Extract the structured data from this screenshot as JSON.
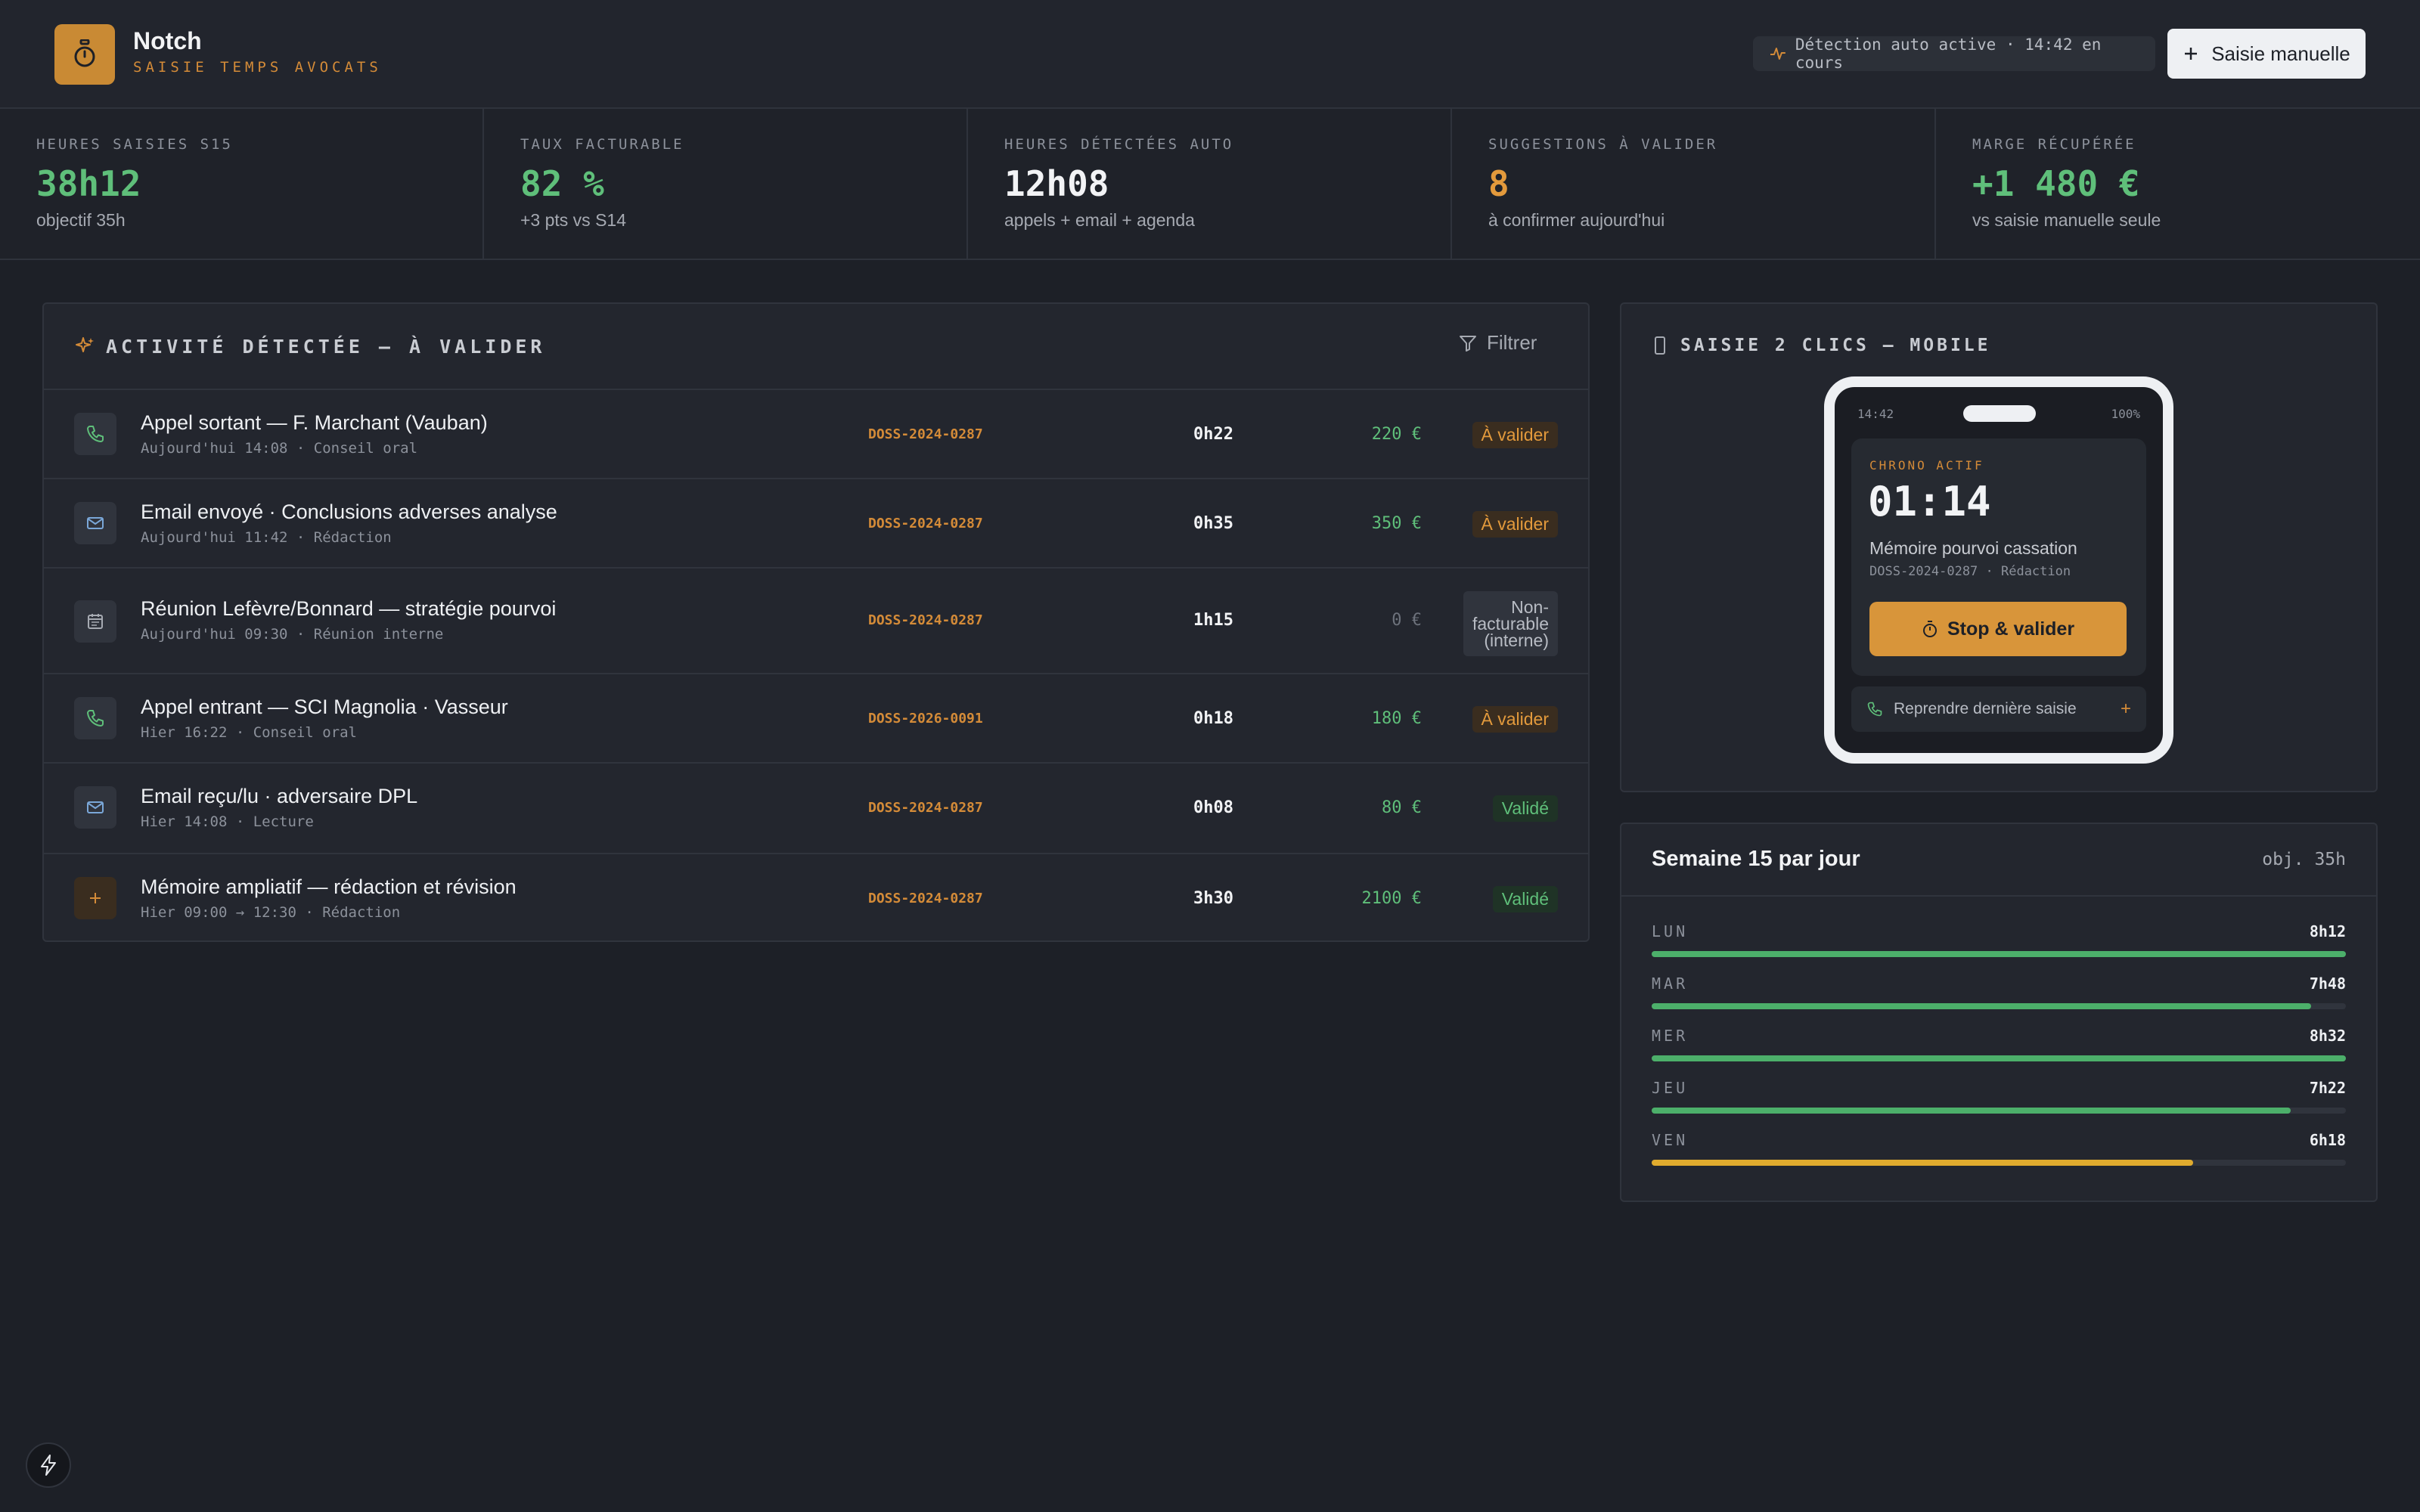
{
  "app": {
    "name": "Notch",
    "subtitle": "SAISIE TEMPS AVOCATS",
    "accent": "#c98a34"
  },
  "header": {
    "detection_status": "Détection auto active · 14:42 en cours",
    "manual_entry_label": "Saisie manuelle"
  },
  "kpis": [
    {
      "label": "HEURES SAISIES S15",
      "value": "38h12",
      "sub": "objectif 35h",
      "color": "#5fbf7a"
    },
    {
      "label": "TAUX FACTURABLE",
      "value": "82 %",
      "sub": "+3 pts vs S14",
      "color": "#5fbf7a"
    },
    {
      "label": "HEURES DÉTECTÉES AUTO",
      "value": "12h08",
      "sub": "appels + email + agenda",
      "color": "#f2f3f5"
    },
    {
      "label": "SUGGESTIONS À VALIDER",
      "value": "8",
      "sub": "à confirmer aujourd'hui",
      "color": "#e39a3c"
    },
    {
      "label": "MARGE RÉCUPÉRÉE",
      "value": "+1 480 €",
      "sub": "vs saisie manuelle seule",
      "color": "#5fbf7a"
    }
  ],
  "activity": {
    "title": "ACTIVITÉ DÉTECTÉE — À VALIDER",
    "filter_label": "Filtrer",
    "rows": [
      {
        "icon": "phone-icon",
        "title": "Appel sortant — F. Marchant (Vauban)",
        "sub": "Aujourd'hui 14:08 · Conseil oral",
        "dossier": "DOSS-2024-0287",
        "duration": "0h22",
        "amount": "220 €",
        "status": "À valider",
        "status_kind": "pending"
      },
      {
        "icon": "mail-icon",
        "title": "Email envoyé · Conclusions adverses analyse",
        "sub": "Aujourd'hui 11:42 · Rédaction",
        "dossier": "DOSS-2024-0287",
        "duration": "0h35",
        "amount": "350 €",
        "status": "À valider",
        "status_kind": "pending"
      },
      {
        "icon": "calendar-icon",
        "title": "Réunion Lefèvre/Bonnard — stratégie pourvoi",
        "sub": "Aujourd'hui 09:30 · Réunion interne",
        "dossier": "DOSS-2024-0287",
        "duration": "1h15",
        "amount": "0 €",
        "status_lines": [
          "Non-",
          "facturable",
          "(interne)"
        ],
        "status_kind": "non"
      },
      {
        "icon": "phone-icon",
        "title": "Appel entrant — SCI Magnolia · Vasseur",
        "sub": "Hier 16:22 · Conseil oral",
        "dossier": "DOSS-2026-0091",
        "duration": "0h18",
        "amount": "180 €",
        "status": "À valider",
        "status_kind": "pending"
      },
      {
        "icon": "mail-icon",
        "title": "Email reçu/lu · adversaire DPL",
        "sub": "Hier 14:08 · Lecture",
        "dossier": "DOSS-2024-0287",
        "duration": "0h08",
        "amount": "80 €",
        "status": "Validé",
        "status_kind": "ok"
      },
      {
        "icon": "plus-icon",
        "title": "Mémoire ampliatif — rédaction et révision",
        "sub": "Hier 09:00 → 12:30 · Rédaction",
        "dossier": "DOSS-2024-0287",
        "duration": "3h30",
        "amount": "2100 €",
        "status": "Validé",
        "status_kind": "ok"
      }
    ]
  },
  "mobile": {
    "title": "SAISIE 2 CLICS — MOBILE",
    "phone_time": "14:42",
    "phone_battery": "100%",
    "chrono_label": "CHRONO ACTIF",
    "chrono_value": "01:14",
    "task": "Mémoire pourvoi cassation",
    "task_meta": "DOSS-2024-0287 · Rédaction",
    "stop_label": "Stop & valider",
    "resume_label": "Reprendre dernière saisie",
    "resume_plus": "+"
  },
  "week": {
    "title": "Semaine 15 par jour",
    "objective": "obj. 35h",
    "days": [
      {
        "label": "LUN",
        "value": "8h12",
        "fraction": 1.0,
        "color": "#4caf6a"
      },
      {
        "label": "MAR",
        "value": "7h48",
        "fraction": 0.95,
        "color": "#4caf6a"
      },
      {
        "label": "MER",
        "value": "8h32",
        "fraction": 1.0,
        "color": "#4caf6a"
      },
      {
        "label": "JEU",
        "value": "7h22",
        "fraction": 0.92,
        "color": "#4caf6a"
      },
      {
        "label": "VEN",
        "value": "6h18",
        "fraction": 0.78,
        "color": "#e0ab2e"
      }
    ]
  }
}
